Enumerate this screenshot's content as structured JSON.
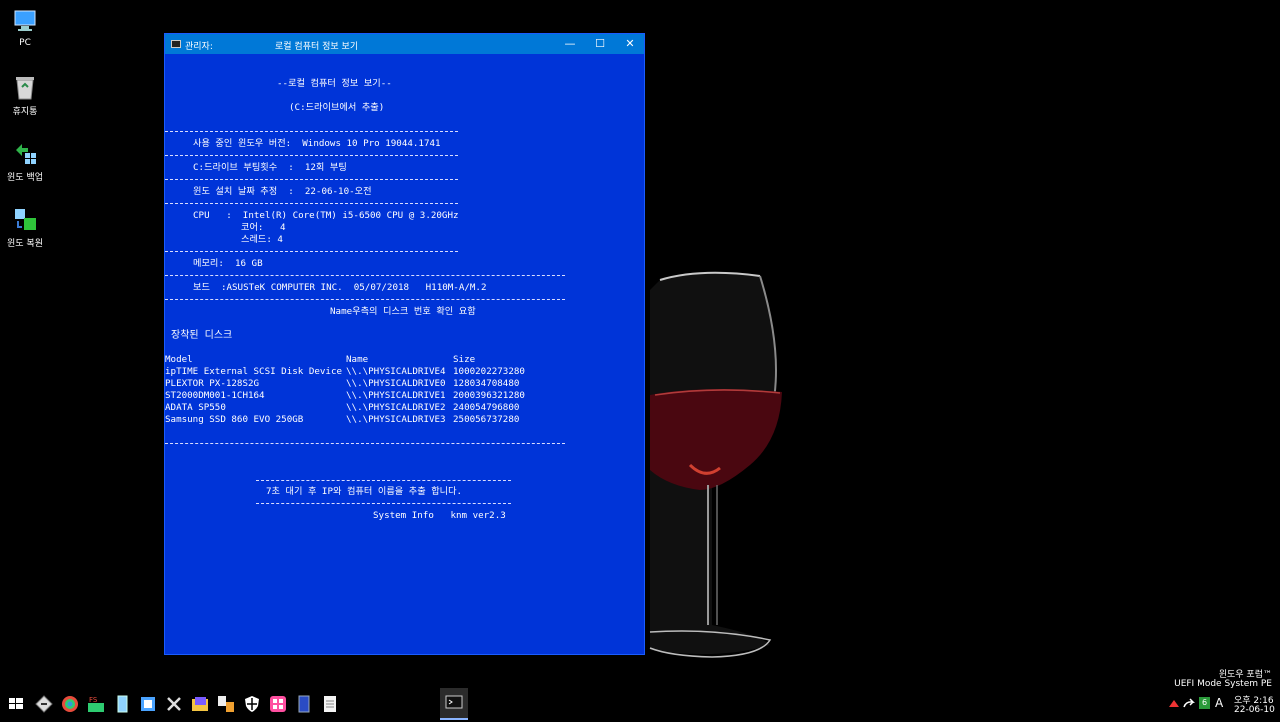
{
  "desktop": {
    "icons": [
      {
        "label": "PC"
      },
      {
        "label": "휴지통"
      },
      {
        "label": "윈도 백업"
      },
      {
        "label": "윈도 복원"
      }
    ]
  },
  "window": {
    "admin_label": "관리자:",
    "title": "로컬 컴퓨터 정보 보기",
    "minimize": "—",
    "maximize": "☐",
    "close": "✕"
  },
  "console": {
    "heading": "--로컬 컴퓨터 정보 보기--",
    "subheading": "(C:드라이브에서 추출)",
    "windows_version": "사용 중인 윈도우 버전:  Windows 10 Pro 19044.1741",
    "boot_count": "C:드라이브 부팅횟수  :  12회 부팅",
    "install_date": "윈도 설치 날짜 추정  :  22-06-10-오전",
    "cpu": "CPU   :  Intel(R) Core(TM) i5-6500 CPU @ 3.20GHz",
    "cores": "코어:   4",
    "threads": "스레드: 4",
    "memory": "메모리:  16 GB",
    "board": "보드  :ASUSTeK COMPUTER INC.  05/07/2018   H110M-A/M.2",
    "name_note": "Name우측의 디스크 번호 확인 요함",
    "disks_title": "장착된 디스크",
    "disk_headers": {
      "model": "Model",
      "name": "Name",
      "size": "Size"
    },
    "disks": [
      {
        "model": "ipTIME External SCSI Disk Device",
        "name": "\\\\.\\PHYSICALDRIVE4",
        "size": "1000202273280"
      },
      {
        "model": "PLEXTOR PX-128S2G",
        "name": "\\\\.\\PHYSICALDRIVE0",
        "size": "128034708480"
      },
      {
        "model": "ST2000DM001-1CH164",
        "name": "\\\\.\\PHYSICALDRIVE1",
        "size": "2000396321280"
      },
      {
        "model": "ADATA SP550",
        "name": "\\\\.\\PHYSICALDRIVE2",
        "size": "240054796800"
      },
      {
        "model": "Samsung SSD 860 EVO 250GB",
        "name": "\\\\.\\PHYSICALDRIVE3",
        "size": "250056737280"
      }
    ],
    "wait_msg": "7초 대기 후 IP와 컴퓨터 이름을 추출 합니다.",
    "footer": "System Info   knm ver2.3"
  },
  "watermark": {
    "line1": "윈도우 포럼™",
    "line2": "UEFI Mode System PE"
  },
  "tray": {
    "lang_num": "6",
    "ime": "A",
    "time": "오후 2:16",
    "date": "22-06-10"
  },
  "colors": {
    "console_bg": "#0034d8",
    "titlebar": "#0078d7",
    "desktop_bg": "#000000"
  }
}
